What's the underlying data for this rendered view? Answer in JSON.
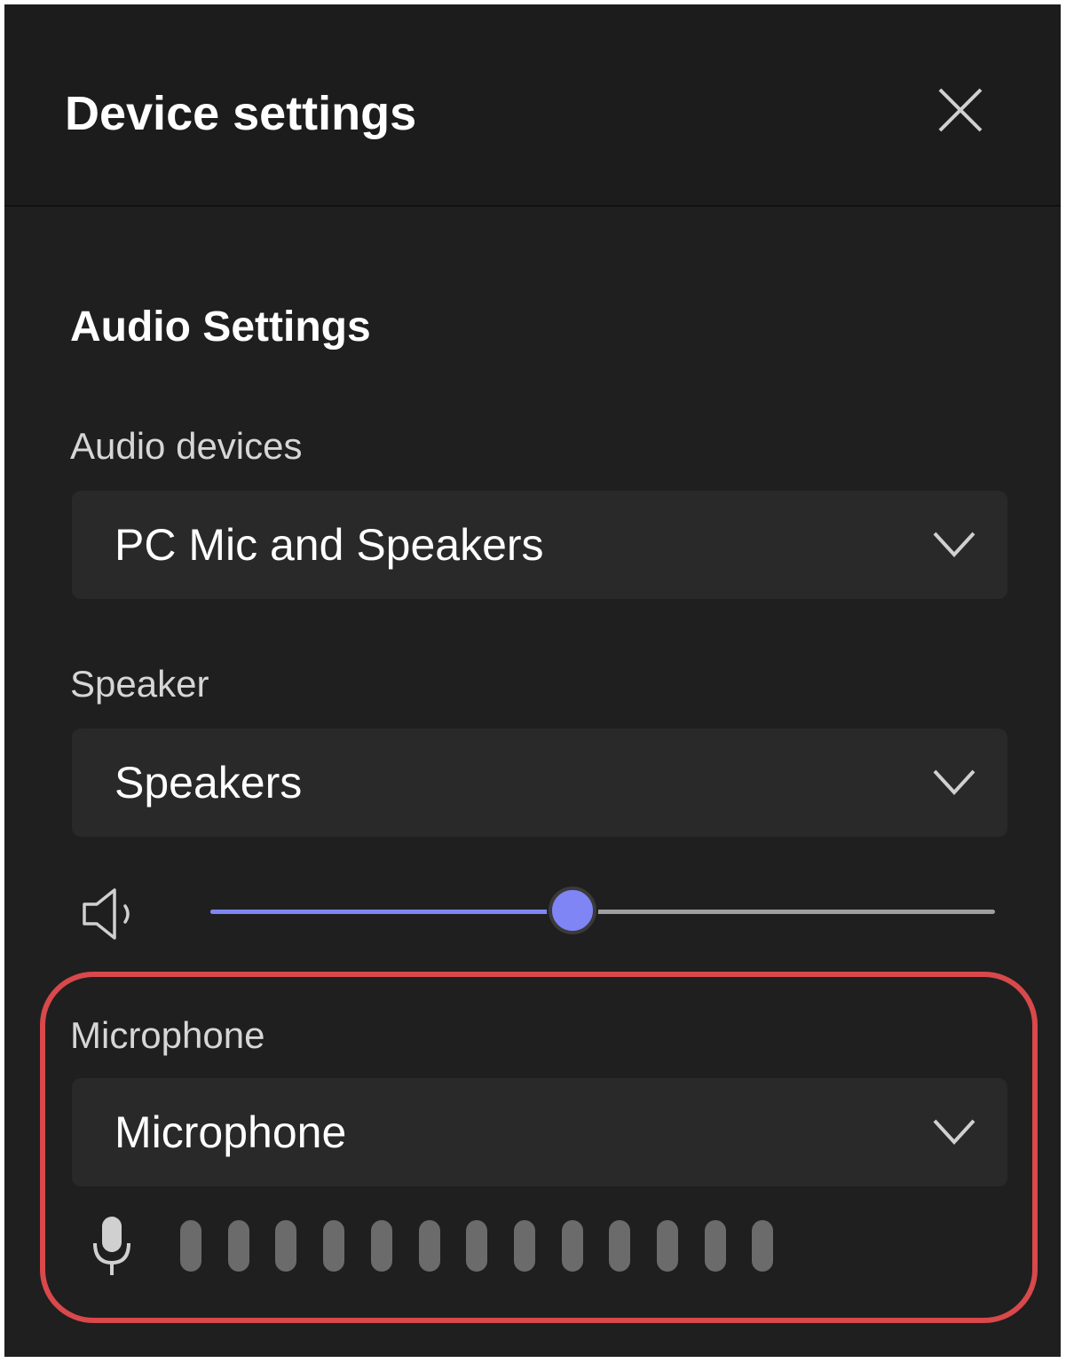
{
  "header": {
    "title": "Device settings",
    "close_icon": "close-icon"
  },
  "audio": {
    "section_title": "Audio Settings",
    "devices_label": "Audio devices",
    "devices_value": "PC Mic and Speakers",
    "speaker_label": "Speaker",
    "speaker_value": "Speakers",
    "speaker_volume_percent": 46,
    "microphone_label": "Microphone",
    "microphone_value": "Microphone",
    "mic_level_segments": 13,
    "mic_level_active": 0
  },
  "colors": {
    "panel_bg": "#1f1f1f",
    "select_bg": "#292929",
    "accent": "#7f85f5",
    "highlight": "#d9484b",
    "meter_idle": "#6b6b6b"
  }
}
